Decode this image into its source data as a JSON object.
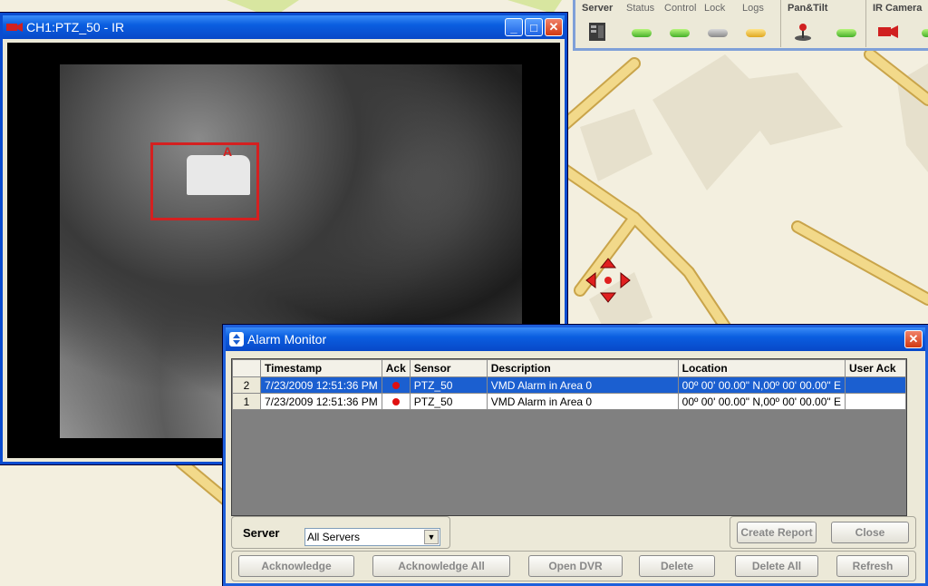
{
  "video_window": {
    "title": "CH1:PTZ_50 - IR",
    "target_label": "A"
  },
  "status_panel": {
    "server_header": "Server",
    "status_header": "Status",
    "control_header": "Control",
    "lock_header": "Lock",
    "logs_header": "Logs",
    "pantilt_header": "Pan&Tilt",
    "ircamera_header": "IR Camera",
    "colors": {
      "status": "#46b02a",
      "control": "#46b02a",
      "lock": "#8a8a8a",
      "logs": "#e0a820",
      "pantilt": "#46b02a"
    }
  },
  "alarm_monitor": {
    "title": "Alarm Monitor",
    "columns": [
      "Timestamp",
      "Ack",
      "Sensor",
      "Description",
      "Location",
      "User Ack"
    ],
    "rows": [
      {
        "no": "2",
        "timestamp": "7/23/2009 12:51:36 PM",
        "sensor": "PTZ_50",
        "description": "VMD Alarm in Area 0",
        "location": "00º 00' 00.00\" N,00º 00' 00.00\" E",
        "user_ack": "",
        "selected": true
      },
      {
        "no": "1",
        "timestamp": "7/23/2009 12:51:36 PM",
        "sensor": "PTZ_50",
        "description": "VMD Alarm in Area 0",
        "location": "00º 00' 00.00\" N,00º 00' 00.00\" E",
        "user_ack": "",
        "selected": false
      }
    ],
    "server_label": "Server",
    "server_value": "All Servers",
    "buttons": {
      "create_report": "Create Report",
      "close": "Close",
      "acknowledge": "Acknowledge",
      "acknowledge_all": "Acknowledge All",
      "open_dvr": "Open DVR",
      "delete": "Delete",
      "delete_all": "Delete All",
      "refresh": "Refresh"
    }
  },
  "colors": {
    "titlebar": "#0a5ee0",
    "alert": "#d42020",
    "map_road": "#e8c46a"
  }
}
